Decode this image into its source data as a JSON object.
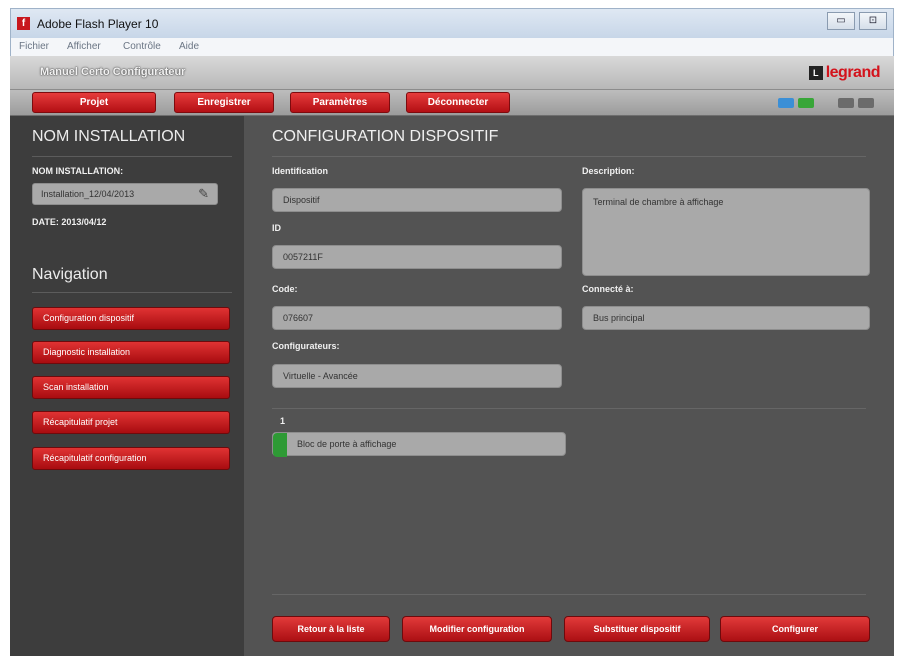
{
  "window": {
    "title": "Adobe Flash Player 10",
    "controls": {
      "minimize": "▭",
      "maximize": "⊡"
    }
  },
  "menubar": {
    "items": [
      "Fichier",
      "Afficher",
      "Contrôle",
      "Aide"
    ]
  },
  "app": {
    "title": "Manuel Certo Configurateur"
  },
  "brand": {
    "mark": "L",
    "name": "legrand"
  },
  "toolbar": {
    "buttons": [
      "Projet",
      "Enregistrer",
      "Paramètres",
      "Déconnecter"
    ],
    "status_colors": [
      "#3b8fd6",
      "#38a638",
      "#6b6b6b",
      "#6b6b6b"
    ]
  },
  "sidebar": {
    "heading": "NOM INSTALLATION",
    "name_label": "NOM INSTALLATION:",
    "name_value": "Installation_12/04/2013",
    "date": "DATE: 2013/04/12",
    "nav_heading": "Navigation",
    "nav_items": [
      "Configuration dispositif",
      "Diagnostic installation",
      "Scan installation",
      "Récapitulatif projet",
      "Récapitulatif configuration"
    ]
  },
  "main": {
    "heading": "CONFIGURATION DISPOSITIF",
    "identification_label": "Identification",
    "identification_value": "Dispositif",
    "id_label": "ID",
    "id_value": "0057211F",
    "code_label": "Code:",
    "code_value": "076607",
    "configurators_label": "Configurateurs:",
    "configurators_value": "Virtuelle - Avancée",
    "description_label": "Description:",
    "description_value": "Terminal de chambre à affichage",
    "connected_label": "Connecté à:",
    "connected_value": "Bus principal",
    "slot_number": "1",
    "slot_value": "Bloc de porte à affichage"
  },
  "actions": [
    "Retour à la liste",
    "Modifier configuration",
    "Substituer dispositif",
    "Configurer"
  ]
}
